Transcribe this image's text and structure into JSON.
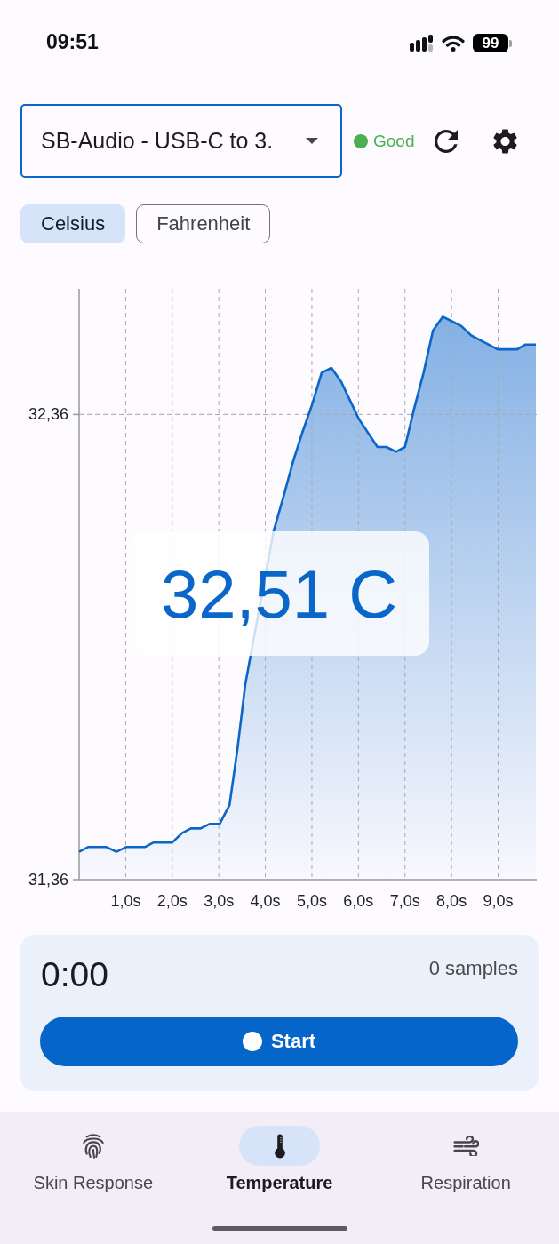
{
  "status_bar": {
    "time": "09:51",
    "battery": "99"
  },
  "device_select": {
    "value": "SB-Audio - USB-C to 3."
  },
  "connection": {
    "label": "Good",
    "color": "#4caf50"
  },
  "units": [
    {
      "label": "Celsius",
      "selected": true
    },
    {
      "label": "Fahrenheit",
      "selected": false
    }
  ],
  "chart": {
    "readout": "32,51 C",
    "chart_data": {
      "type": "area",
      "grid": true,
      "x": [
        0,
        0.19,
        0.59,
        0.8,
        1.01,
        1.41,
        1.6,
        2,
        2.21,
        2.4,
        2.61,
        2.81,
        3.02,
        3.23,
        3.4,
        3.57,
        3.68,
        4.18,
        4.41,
        4.6,
        4.79,
        5,
        5.21,
        5.42,
        5.63,
        6.01,
        6.41,
        6.6,
        6.81,
        7,
        7.19,
        7.4,
        7.6,
        7.81,
        8.21,
        8.42,
        8.99,
        9.41,
        9.58,
        9.81
      ],
      "series": [
        {
          "color": "#0a66c8",
          "values": [
            31.42,
            31.43,
            31.43,
            31.42,
            31.43,
            31.43,
            31.44,
            31.44,
            31.46,
            31.47,
            31.47,
            31.48,
            31.48,
            31.52,
            31.64,
            31.78,
            31.84,
            32.11,
            32.19,
            32.26,
            32.32,
            32.38,
            32.45,
            32.46,
            32.43,
            32.35,
            32.29,
            32.29,
            32.28,
            32.29,
            32.37,
            32.45,
            32.54,
            32.57,
            32.55,
            32.53,
            32.5,
            32.5,
            32.51,
            32.51
          ]
        }
      ],
      "xlim": [
        0,
        9.83
      ],
      "ylim": [
        31.36,
        32.63
      ],
      "xticks": [
        {
          "value": 1,
          "label": "1,0s"
        },
        {
          "value": 2,
          "label": "2,0s"
        },
        {
          "value": 3,
          "label": "3,0s"
        },
        {
          "value": 4,
          "label": "4,0s"
        },
        {
          "value": 5,
          "label": "5,0s"
        },
        {
          "value": 6,
          "label": "6,0s"
        },
        {
          "value": 7,
          "label": "7,0s"
        },
        {
          "value": 8,
          "label": "8,0s"
        },
        {
          "value": 9,
          "label": "9,0s"
        }
      ],
      "yticks": [
        {
          "value": 31.36,
          "label": "31,36"
        },
        {
          "value": 32.36,
          "label": "32,36"
        }
      ]
    }
  },
  "recording": {
    "elapsed": "0:00",
    "samples": "0 samples",
    "start_label": "Start"
  },
  "bottom_nav": [
    {
      "label": "Skin Response",
      "selected": false
    },
    {
      "label": "Temperature",
      "selected": true
    },
    {
      "label": "Respiration",
      "selected": false
    }
  ]
}
